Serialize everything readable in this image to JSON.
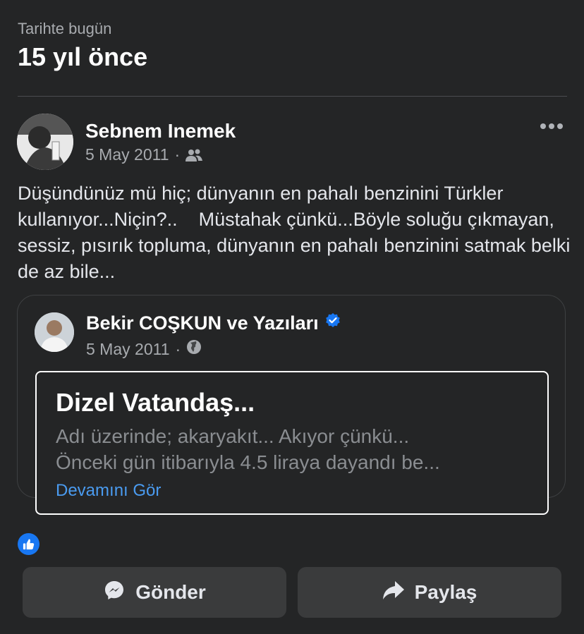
{
  "memory": {
    "kicker": "Tarihte bugün",
    "heading": "15 yıl önce"
  },
  "post": {
    "author": "Sebnem Inemek",
    "date": "5 May 2011",
    "separator": "·",
    "audience_icon": "friends-icon",
    "text": "Düşündünüz mü hiç; dünyanın en pahalı benzinini Türkler kullanıyor...Niçin?..    Müstahak çünkü...Böyle soluğu çıkmayan, sessiz, pısırık topluma, dünyanın en pahalı benzinini satmak belki de az bile..."
  },
  "shared_post": {
    "author": "Bekir COŞKUN ve Yazıları",
    "verified_icon": "verified-badge-icon",
    "date": "5 May 2011",
    "separator": "·",
    "audience_icon": "globe-icon",
    "article": {
      "title": "Dizel Vatandaş...",
      "line1": "Adı üzerinde;  akaryakıt... Akıyor çünkü...",
      "line2": "Önceki gün itibarıyla  4.5 liraya  dayandı be...",
      "see_more": "Devamını Gör"
    }
  },
  "reactions": {
    "icon": "like-icon"
  },
  "actions": {
    "send_label": "Gönder",
    "send_icon": "messenger-icon",
    "share_label": "Paylaş",
    "share_icon": "share-arrow-icon"
  },
  "colors": {
    "background": "#242526",
    "accent": "#1877f2",
    "link": "#4a9bf0",
    "button_bg": "#3a3b3c"
  }
}
